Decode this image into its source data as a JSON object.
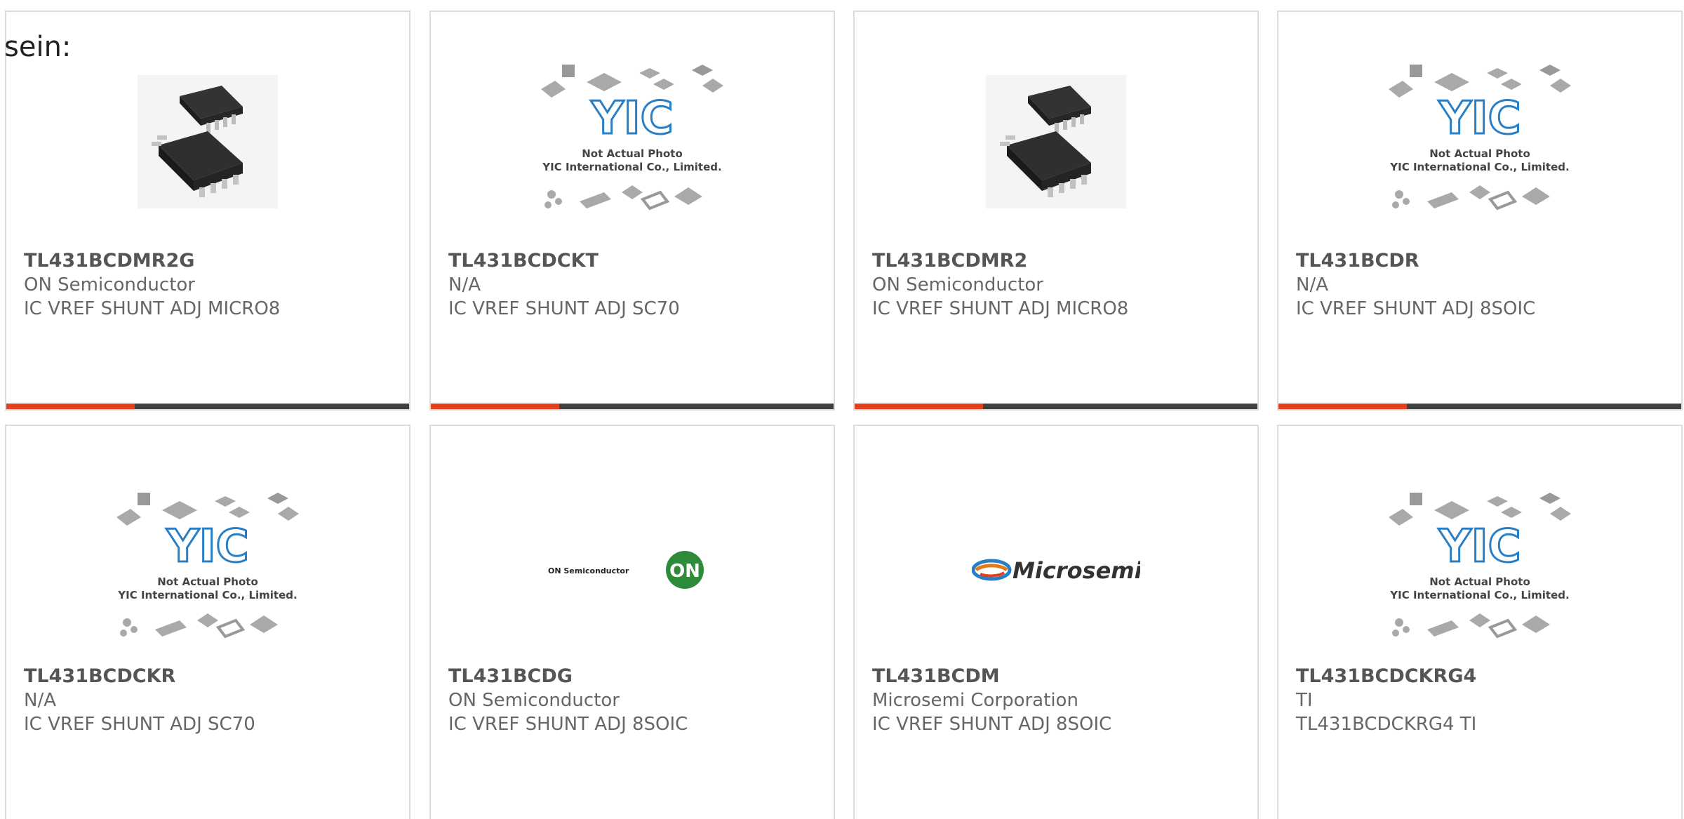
{
  "intro_text": "sein:",
  "colors": {
    "accent": "#e3401c",
    "bar": "#404040",
    "card_border": "#dcdcdc",
    "yic_blue": "#2a7fc4",
    "on_green": "#2e8b3a"
  },
  "products": [
    {
      "part": "TL431BCDMR2G",
      "manufacturer": "ON Semiconductor",
      "description": "IC VREF SHUNT ADJ MICRO8",
      "image": "micro8-chip"
    },
    {
      "part": "TL431BCDCKT",
      "manufacturer": "N/A",
      "description": "IC VREF SHUNT ADJ SC70",
      "image": "yic-placeholder"
    },
    {
      "part": "TL431BCDMR2",
      "manufacturer": "ON Semiconductor",
      "description": "IC VREF SHUNT ADJ MICRO8",
      "image": "micro8-chip"
    },
    {
      "part": "TL431BCDR",
      "manufacturer": "N/A",
      "description": "IC VREF SHUNT ADJ 8SOIC",
      "image": "yic-placeholder"
    },
    {
      "part": "TL431BCDCKR",
      "manufacturer": "N/A",
      "description": "IC VREF SHUNT ADJ SC70",
      "image": "yic-placeholder"
    },
    {
      "part": "TL431BCDG",
      "manufacturer": "ON Semiconductor",
      "description": "IC VREF SHUNT ADJ 8SOIC",
      "image": "on-semiconductor-logo"
    },
    {
      "part": "TL431BCDM",
      "manufacturer": "Microsemi Corporation",
      "description": "IC VREF SHUNT ADJ 8SOIC",
      "image": "microsemi-logo"
    },
    {
      "part": "TL431BCDCKRG4",
      "manufacturer": "TI",
      "description": "TL431BCDCKRG4 TI",
      "image": "yic-placeholder"
    }
  ],
  "yic_placeholder": {
    "logo": "YIC",
    "line1": "Not Actual Photo",
    "line2": "YIC International Co., Limited."
  },
  "on_logo": {
    "wordmark": "ON Semiconductor",
    "badge": "ON"
  },
  "microsemi_logo": {
    "wordmark": "Microsemi"
  }
}
